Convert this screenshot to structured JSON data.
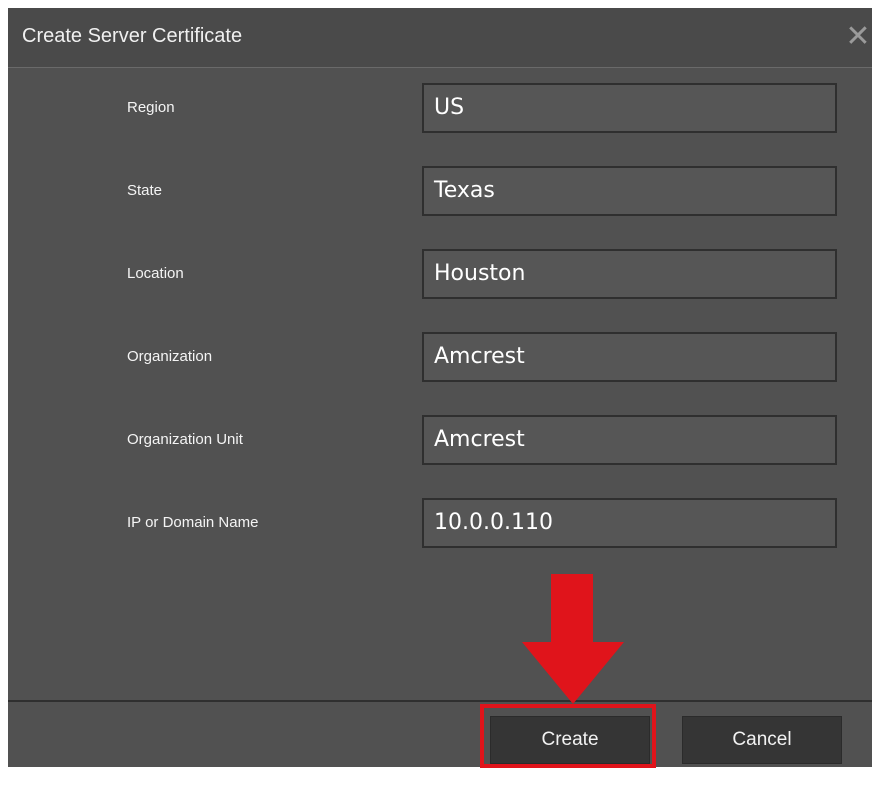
{
  "dialog": {
    "title": "Create Server Certificate",
    "close_icon": "close-icon",
    "fields": [
      {
        "label": "Region",
        "value": "US"
      },
      {
        "label": "State",
        "value": "Texas"
      },
      {
        "label": "Location",
        "value": "Houston"
      },
      {
        "label": "Organization",
        "value": "Amcrest"
      },
      {
        "label": "Organization Unit",
        "value": "Amcrest"
      },
      {
        "label": "IP or Domain Name",
        "value": "10.0.0.110"
      }
    ],
    "buttons": {
      "create": "Create",
      "cancel": "Cancel"
    }
  },
  "annotation": {
    "arrow_icon": "down-arrow-icon",
    "color": "#e0141b"
  }
}
